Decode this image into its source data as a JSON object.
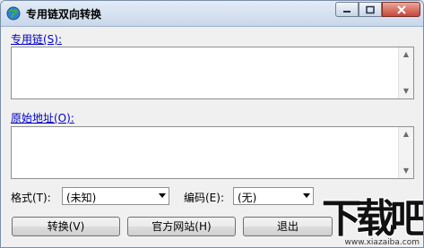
{
  "window": {
    "title": "专用链双向转换"
  },
  "private_link": {
    "label": "专用链(S):",
    "value": ""
  },
  "original_address": {
    "label": "原始地址(O):",
    "value": ""
  },
  "format": {
    "label": "格式(T):",
    "selected": "(未知)"
  },
  "encoding": {
    "label": "编码(E):",
    "selected": "(无)"
  },
  "buttons": {
    "convert": "转换(V)",
    "official_site": "官方网站(H)",
    "exit": "退出"
  },
  "watermark": {
    "logo_text": "下载吧",
    "url": "www.xiazaiba.com"
  },
  "icons": {
    "app": "globe-icon",
    "minimize": "minimize-icon",
    "maximize": "maximize-icon",
    "close": "close-icon"
  }
}
